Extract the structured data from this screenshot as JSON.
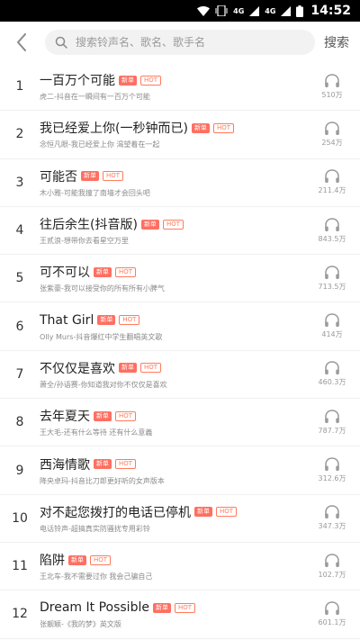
{
  "status_bar": {
    "network_label_1": "4G",
    "network_label_2": "4G",
    "time": "14:52"
  },
  "search": {
    "placeholder": "搜索铃声名、歌名、歌手名",
    "button_label": "搜索"
  },
  "icons": {
    "back": "chevron-left-icon",
    "search": "search-icon",
    "listen": "headphones-icon"
  },
  "colors": {
    "accent": "#ff6f61",
    "hot": "#ff7b5c",
    "subtitle": "#8a8a8a"
  },
  "songs": [
    {
      "rank": "1",
      "title": "一百万个可能",
      "badge_new": "新单",
      "badge_hot": "HOT",
      "subtitle": "虎二-抖音在一瞬间有一百万个可能",
      "plays": "510万"
    },
    {
      "rank": "2",
      "title": "我已经爱上你(一秒钟而已)",
      "badge_new": "新单",
      "badge_hot": "HOT",
      "subtitle": "念恒凡眼-我已经爱上你 渴望着在一起",
      "plays": "254万"
    },
    {
      "rank": "3",
      "title": "可能否",
      "badge_new": "新单",
      "badge_hot": "HOT",
      "subtitle": "木小雅-可能我撞了南墙才会回头吧",
      "plays": "211.4万"
    },
    {
      "rank": "4",
      "title": "往后余生(抖音版)",
      "badge_new": "新单",
      "badge_hot": "HOT",
      "subtitle": "王贰浪-想带你去看星空万里",
      "plays": "843.5万"
    },
    {
      "rank": "5",
      "title": "可不可以",
      "badge_new": "新单",
      "badge_hot": "HOT",
      "subtitle": "张紫豪-我可以接受你的所有所有小脾气",
      "plays": "713.5万"
    },
    {
      "rank": "6",
      "title": "That Girl",
      "badge_new": "新单",
      "badge_hot": "HOT",
      "subtitle": "Olly Murs-抖音爆红中学生翻唱英文歌",
      "plays": "414万"
    },
    {
      "rank": "7",
      "title": "不仅仅是喜欢",
      "badge_new": "新单",
      "badge_hot": "HOT",
      "subtitle": "萧全/孙语赛-你知道我对你不仅仅是喜欢",
      "plays": "460.3万"
    },
    {
      "rank": "8",
      "title": "去年夏天",
      "badge_new": "新单",
      "badge_hot": "HOT",
      "subtitle": "王大毛-还有什么等待 还有什么意義",
      "plays": "787.7万"
    },
    {
      "rank": "9",
      "title": "西海情歌",
      "badge_new": "新单",
      "badge_hot": "HOT",
      "subtitle": "降央卓玛-抖音比刀郎更好听的女声版本",
      "plays": "312.6万"
    },
    {
      "rank": "10",
      "title": "对不起您拨打的电话已停机",
      "badge_new": "新单",
      "badge_hot": "HOT",
      "subtitle": "电话铃声-超搞真实防骚扰专用彩铃",
      "plays": "347.3万"
    },
    {
      "rank": "11",
      "title": "陷阱",
      "badge_new": "新单",
      "badge_hot": "HOT",
      "subtitle": "王北车-我不需要过你 我会己骗自己",
      "plays": "102.7万"
    },
    {
      "rank": "12",
      "title": "Dream It Possible",
      "badge_new": "新单",
      "badge_hot": "HOT",
      "subtitle": "张靓颖-《我的梦》英文版",
      "plays": "601.1万"
    }
  ]
}
